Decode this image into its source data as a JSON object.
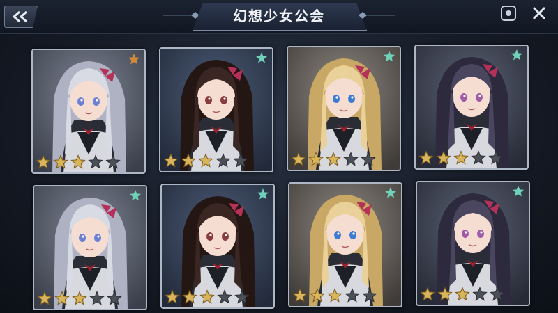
{
  "header": {
    "title": "幻想少女公会"
  },
  "icons": {
    "back": "double-chevron-left-icon",
    "record": "record-icon",
    "close": "close-icon"
  },
  "colors": {
    "star_filled": "#d8b45a",
    "star_empty": "#4b4f57",
    "corner_star_orange": "#d08a3a",
    "corner_star_teal": "#6fd1b8"
  },
  "cards": [
    {
      "character": "silver-hair-girl",
      "stars": 3,
      "max_stars": 5,
      "corner_star": "orange"
    },
    {
      "character": "brown-hair-girl",
      "stars": 3,
      "max_stars": 5,
      "corner_star": "teal"
    },
    {
      "character": "blonde-hair-girl",
      "stars": 3,
      "max_stars": 5,
      "corner_star": "teal"
    },
    {
      "character": "purple-hair-girl",
      "stars": 3,
      "max_stars": 5,
      "corner_star": "teal"
    },
    {
      "character": "silver-hair-girl",
      "stars": 3,
      "max_stars": 5,
      "corner_star": "teal"
    },
    {
      "character": "brown-hair-girl",
      "stars": 3,
      "max_stars": 5,
      "corner_star": "teal"
    },
    {
      "character": "blonde-hair-girl",
      "stars": 3,
      "max_stars": 5,
      "corner_star": "teal"
    },
    {
      "character": "purple-hair-girl",
      "stars": 3,
      "max_stars": 5,
      "corner_star": "teal"
    }
  ]
}
